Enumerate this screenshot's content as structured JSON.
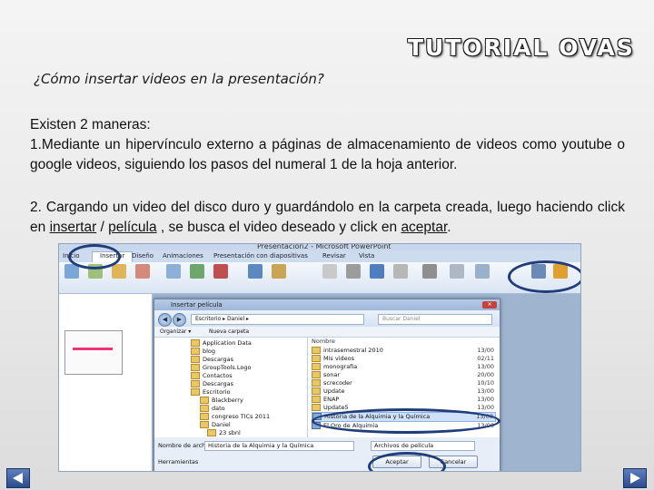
{
  "header": {
    "title": "TUTORIAL OVAS",
    "subtitle": "¿Cómo insertar videos en la presentación?"
  },
  "body": {
    "intro_line1": "Existen 2 maneras:",
    "intro_line2": "1.Mediante un hipervínculo externo a páginas de almacenamiento de videos como youtube o google videos, siguiendo los pasos del numeral 1 de la hoja anterior.",
    "step2_text_a": "2. Cargando un video del disco duro y guardándolo en la carpeta creada, luego haciendo click en ",
    "step2_link_insertar": "insertar",
    "step2_sep": " / ",
    "step2_link_pelicula": "película",
    "step2_text_b": " , se busca el video deseado y click  en ",
    "step2_link_aceptar": "aceptar",
    "step2_end": "."
  },
  "screenshot": {
    "window_title": "Presentación2 - Microsoft PowerPoint",
    "tabs": [
      "Inicio",
      "Insertar",
      "Diseño",
      "Animaciones",
      "Presentación con diapositivas",
      "Revisar",
      "Vista"
    ],
    "dialog": {
      "title": "Insertar película",
      "address": "Escritorio ▸ Daniel ▸",
      "search_placeholder": "Buscar Daniel",
      "organize": "Organizar ▾",
      "new_folder": "Nueva carpeta",
      "tree_items": [
        "Application Data",
        "blog",
        "Descargas",
        "GroupTools.Logo",
        "Contactos",
        "Descargas",
        "Escritorio",
        "Blackberry",
        "dato",
        "congreso TICs 2011",
        "Daniel",
        "23 sbnl"
      ],
      "column_name": "Nombre",
      "files": [
        {
          "name": "intrasemestral 2010",
          "date": "13/00"
        },
        {
          "name": "Mis videos",
          "date": "02/11"
        },
        {
          "name": "monografia",
          "date": "13/00"
        },
        {
          "name": "sonar",
          "date": "20/00"
        },
        {
          "name": "screcoder",
          "date": "10/10"
        },
        {
          "name": "Update",
          "date": "13/00"
        },
        {
          "name": "ENAP",
          "date": "13/00"
        },
        {
          "name": "Update5",
          "date": "13/00"
        },
        {
          "name": "Historia de la Alquimia y la Química",
          "date": "13/00"
        },
        {
          "name": "El Oro de Alquimia",
          "date": "13/00"
        }
      ],
      "filename_label": "Nombre de archivo:",
      "filename_value": "Historia de la Alquimia y la Química",
      "filetype_value": "Archivos de película",
      "accept_label": "Aceptar",
      "cancel_label": "Cancelar",
      "tools_label": "Herramientas"
    }
  },
  "colors": {
    "highlight_circle": "#1f3d7a",
    "nav_button": "#3b5ea6"
  },
  "icons": {
    "prev": "triangle-left-icon",
    "next": "triangle-right-icon"
  }
}
